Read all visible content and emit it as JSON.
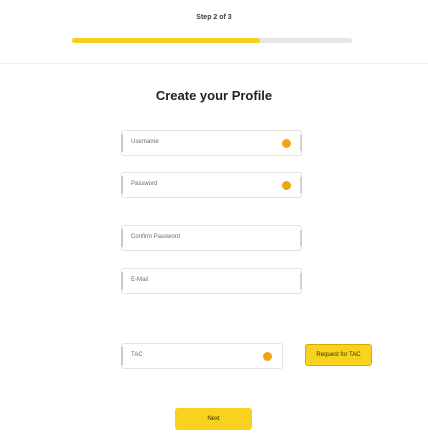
{
  "header": {
    "step_label": "Step 2 of 3",
    "progress_fraction": 0.67
  },
  "form": {
    "title": "Create your Profile",
    "fields": [
      {
        "placeholder": "Username",
        "value": "",
        "status": "warning"
      },
      {
        "placeholder": "Password",
        "value": "",
        "status": "warning"
      },
      {
        "placeholder": "Confirm Password",
        "value": "",
        "status": "none"
      },
      {
        "placeholder": "E-Mail",
        "value": "",
        "status": "none"
      },
      {
        "placeholder": "TAC",
        "value": "",
        "status": "warning"
      }
    ],
    "request_tac_label": "Request for TAC",
    "next_label": "Next"
  },
  "colors": {
    "accent": "#f7d21e",
    "status_warning": "#f0a50f",
    "progress_fill": "#f6ce1b"
  }
}
